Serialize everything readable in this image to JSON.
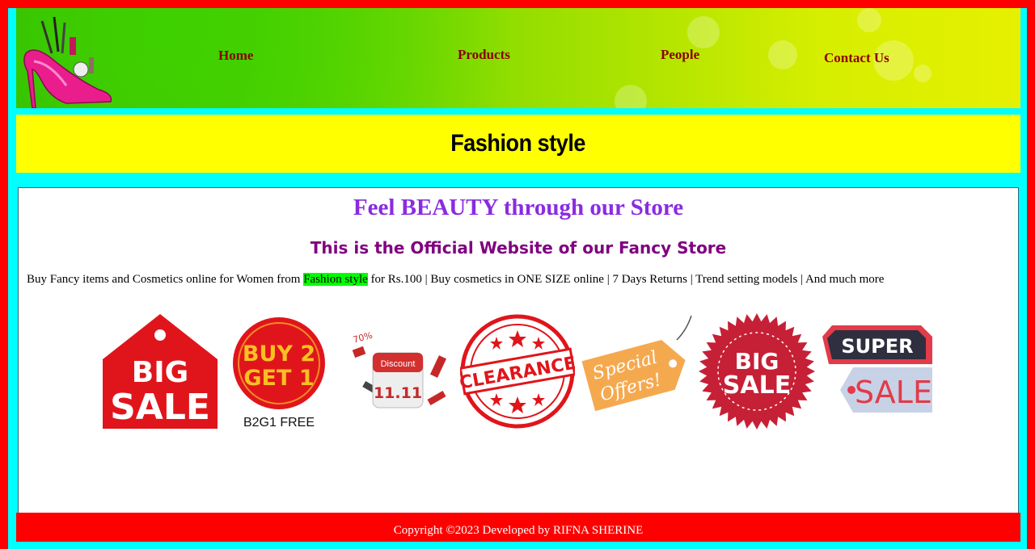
{
  "nav": {
    "home": "Home",
    "products": "Products",
    "people": "People",
    "contact": "Contact Us"
  },
  "banner": {
    "title": "Fashion style"
  },
  "main": {
    "tagline": "Feel BEAUTY through our Store",
    "subtitle": "This is the Official Website of our Fancy Store",
    "desc_before": "Buy Fancy items and Cosmetics online for Women from ",
    "desc_highlight": "Fashion style",
    "desc_after": " for Rs.100 | Buy cosmetics in ONE SIZE online | 7 Days Returns | Trend setting models | And much more"
  },
  "badges": {
    "big_sale_1": {
      "line1": "BIG",
      "line2": "SALE"
    },
    "buy2get1": {
      "line1": "BUY 2",
      "line2": "GET 1",
      "caption": "B2G1 FREE"
    },
    "discount": {
      "label": "Discount",
      "date": "11.11",
      "pct": "70%"
    },
    "clearance": {
      "label": "CLEARANCE"
    },
    "special": {
      "line1": "Special",
      "line2": "Offers!"
    },
    "big_sale_2": {
      "line1": "BIG",
      "line2": "SALE"
    },
    "super_sale": {
      "line1": "SUPER",
      "line2": "SALE"
    }
  },
  "footer": {
    "text": "Copyright ©2023 Developed by RIFNA SHERINE"
  },
  "colors": {
    "page_border": "#ff0000",
    "frame": "#00ffff",
    "banner": "#ffff00",
    "nav_link": "#8b0000",
    "tagline": "#8a2be2",
    "highlight": "#00ff00"
  }
}
